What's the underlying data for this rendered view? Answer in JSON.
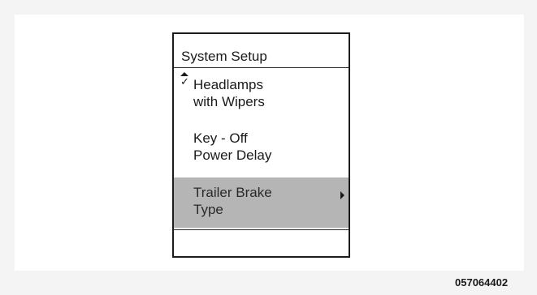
{
  "screen": {
    "title": "System Setup",
    "menu_items": [
      {
        "label": "Headlamps\nwith Wipers",
        "checked": true,
        "selected": false
      },
      {
        "label": "Key - Off\nPower Delay",
        "checked": false,
        "selected": false
      },
      {
        "label": "Trailer Brake\nType",
        "checked": false,
        "selected": true,
        "has_submenu": true
      },
      {
        "label": "",
        "checked": false,
        "selected": false
      }
    ],
    "icons": {
      "scroll_up": "scroll-up-arrow",
      "check": "checkmark",
      "submenu": "submenu-right-arrow"
    },
    "colors": {
      "highlight": "#b5b5b5",
      "border": "#1c1c1c"
    }
  },
  "figure": {
    "id": "057064402"
  }
}
